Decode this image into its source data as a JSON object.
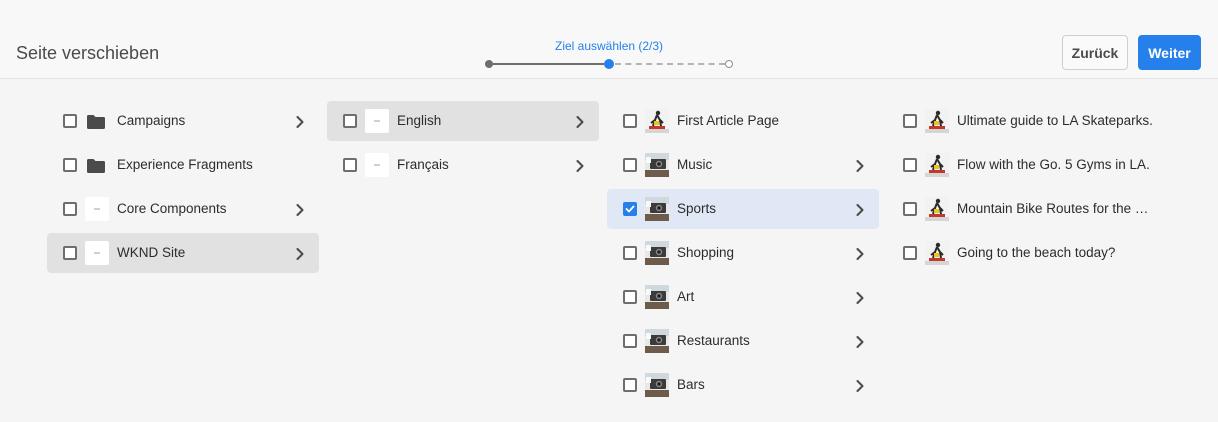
{
  "header": {
    "title": "Seite verschieben",
    "step_label": "Ziel auswählen (2/3)",
    "back_label": "Zurück",
    "next_label": "Weiter"
  },
  "columns": [
    {
      "items": [
        {
          "label": "Campaigns",
          "icon": "folder-icon",
          "expandable": true
        },
        {
          "label": "Experience Fragments",
          "icon": "folder-icon",
          "expandable": false
        },
        {
          "label": "Core Components",
          "icon": "page-icon",
          "expandable": true
        },
        {
          "label": "WKND Site",
          "icon": "page-icon",
          "expandable": true,
          "highlighted": true
        }
      ]
    },
    {
      "items": [
        {
          "label": "English",
          "icon": "page-icon",
          "expandable": true,
          "highlighted": true
        },
        {
          "label": "Français",
          "icon": "page-icon",
          "expandable": true
        }
      ]
    },
    {
      "items": [
        {
          "label": "First Article Page",
          "icon": "skater-thumbnail",
          "expandable": false
        },
        {
          "label": "Music",
          "icon": "camera-thumbnail",
          "expandable": true
        },
        {
          "label": "Sports",
          "icon": "camera-thumbnail",
          "expandable": true,
          "checked": true
        },
        {
          "label": "Shopping",
          "icon": "camera-thumbnail",
          "expandable": true
        },
        {
          "label": "Art",
          "icon": "camera-thumbnail",
          "expandable": true
        },
        {
          "label": "Restaurants",
          "icon": "camera-thumbnail",
          "expandable": true
        },
        {
          "label": "Bars",
          "icon": "camera-thumbnail",
          "expandable": true
        }
      ]
    },
    {
      "items": [
        {
          "label": "Ultimate guide to LA Skateparks.",
          "icon": "skater-thumbnail",
          "expandable": false
        },
        {
          "label": "Flow with the Go. 5 Gyms in LA.",
          "icon": "skater-thumbnail",
          "expandable": false
        },
        {
          "label": "Mountain Bike Routes for the …",
          "icon": "skater-thumbnail",
          "expandable": false
        },
        {
          "label": "Going to the beach today?",
          "icon": "skater-thumbnail",
          "expandable": false
        }
      ]
    }
  ],
  "colors": {
    "accent": "#2680eb",
    "highlight": "#e1e1e1",
    "selected": "#e1e8f5"
  }
}
